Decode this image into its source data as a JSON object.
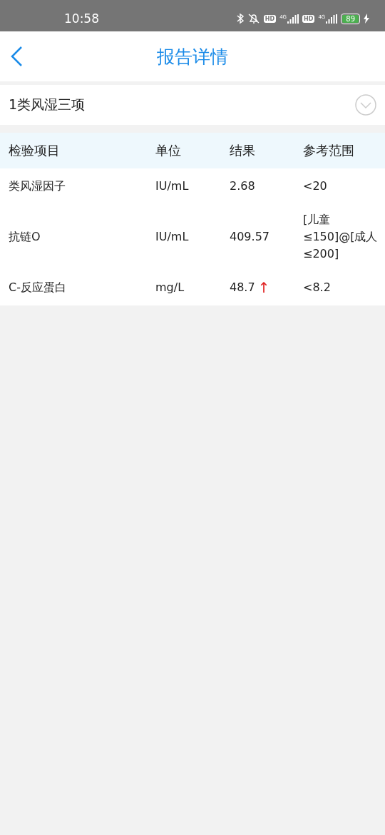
{
  "status_bar": {
    "time": "10:58",
    "indicators": [
      {
        "kind": "bluetooth"
      },
      {
        "kind": "bell-off"
      },
      {
        "kind": "hd",
        "label": "HD"
      },
      {
        "kind": "signal",
        "label": "4G"
      },
      {
        "kind": "hd",
        "label": "HD"
      },
      {
        "kind": "signal",
        "label": "4G"
      }
    ],
    "battery": "89",
    "charging": true
  },
  "header": {
    "title": "报告详情"
  },
  "section": {
    "title": "1类风湿三项",
    "expanded": false
  },
  "table": {
    "columns": [
      "检验项目",
      "单位",
      "结果",
      "参考范围"
    ],
    "rows": [
      {
        "item": "类风湿因子",
        "unit": "IU/mL",
        "result": "2.68",
        "range": "<20"
      },
      {
        "item": "抗链O",
        "unit": "IU/mL",
        "result": "409.57",
        "range": "[儿童≤150]@[成人≤200]"
      },
      {
        "item": "C-反应蛋白",
        "unit": "mg/L",
        "result": "48.7",
        "flag": "↑",
        "range": "<8.2"
      }
    ]
  }
}
